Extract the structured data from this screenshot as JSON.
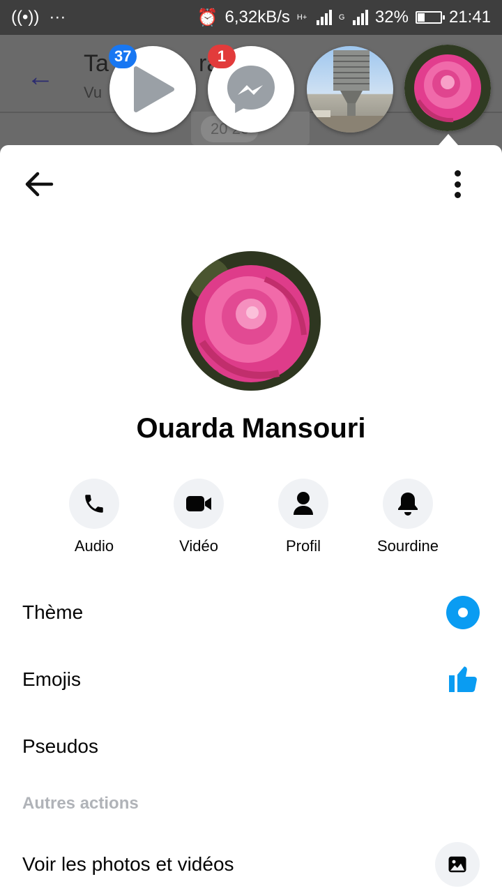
{
  "status_bar": {
    "speed": "6,32kB/s",
    "sim1_network": "H+",
    "sim2_network": "G",
    "battery_percent": "32%",
    "battery_level": 0.32,
    "time": "21:41"
  },
  "background_chat": {
    "title": "Ta",
    "title_end": "ra",
    "subtitle": "Vu",
    "date_fragment": "20      26"
  },
  "chat_heads": {
    "play_badge": "37",
    "messenger_badge": "1"
  },
  "profile": {
    "name": "Ouarda Mansouri"
  },
  "actions": [
    {
      "label": "Audio",
      "icon": "phone-icon"
    },
    {
      "label": "Vidéo",
      "icon": "video-camera-icon"
    },
    {
      "label": "Profil",
      "icon": "person-icon"
    },
    {
      "label": "Sourdine",
      "icon": "bell-icon"
    }
  ],
  "settings": {
    "theme_label": "Thème",
    "theme_color": "#0a9cf2",
    "emojis_label": "Emojis",
    "emoji_color": "#0a9cf2",
    "nicknames_label": "Pseudos",
    "other_actions_header": "Autres actions",
    "view_media_label": "Voir les photos et vidéos"
  }
}
